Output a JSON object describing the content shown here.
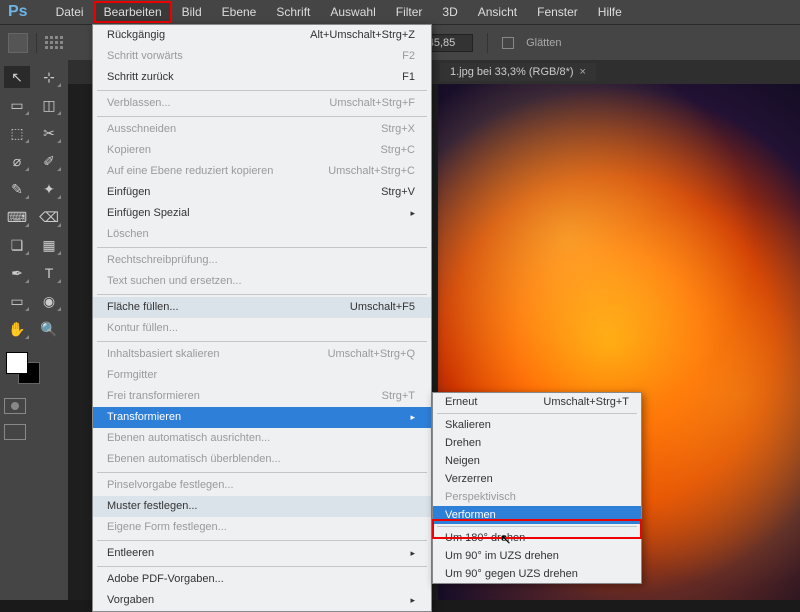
{
  "menubar": {
    "items": [
      "Datei",
      "Bearbeiten",
      "Bild",
      "Ebene",
      "Schrift",
      "Auswahl",
      "Filter",
      "3D",
      "Ansicht",
      "Fenster",
      "Hilfe"
    ],
    "active_index": 1
  },
  "options": {
    "angle_symbol": "⊿",
    "angle_value": "-45,85",
    "smooth_label": "Glätten"
  },
  "tab": {
    "title": "1.jpg bei 33,3% (RGB/8*)",
    "close": "×"
  },
  "tools": {
    "left": [
      "↖",
      "▭",
      "⬚",
      "⌀",
      "✎",
      "⌨",
      "❏",
      "✒",
      "▭",
      "◌",
      "✋",
      "◑"
    ],
    "right": [
      "⊹",
      "◫",
      "✂",
      "✐",
      "✦",
      "⌫",
      "▦",
      "T",
      "◉",
      "🔍",
      "⟲",
      ""
    ]
  },
  "edit_menu": [
    {
      "label": "Rückgängig",
      "shortcut": "Alt+Umschalt+Strg+Z",
      "disabled": false
    },
    {
      "label": "Schritt vorwärts",
      "shortcut": "F2",
      "disabled": true
    },
    {
      "label": "Schritt zurück",
      "shortcut": "F1",
      "disabled": false
    },
    {
      "sep": true
    },
    {
      "label": "Verblassen...",
      "shortcut": "Umschalt+Strg+F",
      "disabled": true
    },
    {
      "sep": true
    },
    {
      "label": "Ausschneiden",
      "shortcut": "Strg+X",
      "disabled": true
    },
    {
      "label": "Kopieren",
      "shortcut": "Strg+C",
      "disabled": true
    },
    {
      "label": "Auf eine Ebene reduziert kopieren",
      "shortcut": "Umschalt+Strg+C",
      "disabled": true
    },
    {
      "label": "Einfügen",
      "shortcut": "Strg+V",
      "disabled": false
    },
    {
      "label": "Einfügen Spezial",
      "shortcut": "",
      "disabled": false,
      "arrow": true
    },
    {
      "label": "Löschen",
      "shortcut": "",
      "disabled": true
    },
    {
      "sep": true
    },
    {
      "label": "Rechtschreibprüfung...",
      "shortcut": "",
      "disabled": true
    },
    {
      "label": "Text suchen und ersetzen...",
      "shortcut": "",
      "disabled": true
    },
    {
      "sep": true
    },
    {
      "label": "Fläche füllen...",
      "shortcut": "Umschalt+F5",
      "disabled": false,
      "shaded": true
    },
    {
      "label": "Kontur füllen...",
      "shortcut": "",
      "disabled": true
    },
    {
      "sep": true
    },
    {
      "label": "Inhaltsbasiert skalieren",
      "shortcut": "Umschalt+Strg+Q",
      "disabled": true
    },
    {
      "label": "Formgitter",
      "shortcut": "",
      "disabled": true
    },
    {
      "label": "Frei transformieren",
      "shortcut": "Strg+T",
      "disabled": true
    },
    {
      "label": "Transformieren",
      "shortcut": "",
      "disabled": false,
      "hl": true,
      "arrow": true
    },
    {
      "label": "Ebenen automatisch ausrichten...",
      "shortcut": "",
      "disabled": true
    },
    {
      "label": "Ebenen automatisch überblenden...",
      "shortcut": "",
      "disabled": true
    },
    {
      "sep": true
    },
    {
      "label": "Pinselvorgabe festlegen...",
      "shortcut": "",
      "disabled": true
    },
    {
      "label": "Muster festlegen...",
      "shortcut": "",
      "disabled": false,
      "shaded": true
    },
    {
      "label": "Eigene Form festlegen...",
      "shortcut": "",
      "disabled": true
    },
    {
      "sep": true
    },
    {
      "label": "Entleeren",
      "shortcut": "",
      "disabled": false,
      "arrow": true
    },
    {
      "sep": true
    },
    {
      "label": "Adobe PDF-Vorgaben...",
      "shortcut": "",
      "disabled": false
    },
    {
      "label": "Vorgaben",
      "shortcut": "",
      "disabled": false,
      "arrow": true
    }
  ],
  "submenu": [
    {
      "label": "Erneut",
      "shortcut": "Umschalt+Strg+T"
    },
    {
      "sep": true
    },
    {
      "label": "Skalieren"
    },
    {
      "label": "Drehen"
    },
    {
      "label": "Neigen"
    },
    {
      "label": "Verzerren"
    },
    {
      "label": "Perspektivisch",
      "disabled": true
    },
    {
      "label": "Verformen",
      "hl": true
    },
    {
      "sep": true
    },
    {
      "label": "Um 180° drehen"
    },
    {
      "label": "Um 90° im UZS drehen"
    },
    {
      "label": "Um 90° gegen UZS drehen"
    }
  ]
}
